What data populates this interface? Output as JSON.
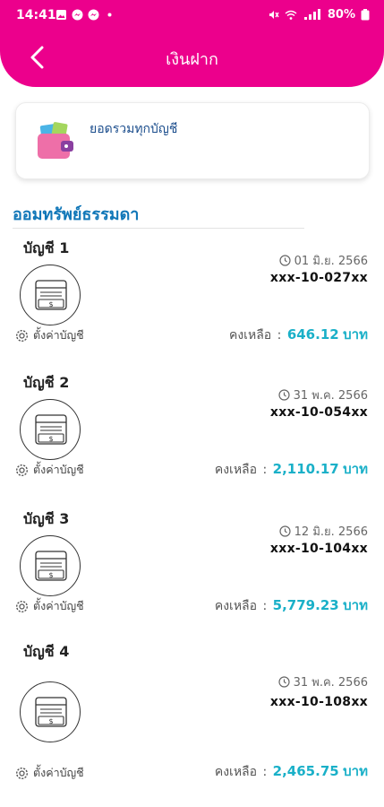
{
  "status_bar": {
    "time": "14:41",
    "battery": "80%"
  },
  "header": {
    "title": "เงินฝาก"
  },
  "summary": {
    "label": "ยอดรวมทุกบัญชี"
  },
  "section": {
    "title": "ออมทรัพย์ธรรมดา"
  },
  "accounts": [
    {
      "name": "บัญชี 1",
      "date": "01 มิ.ย. 2566",
      "number": "xxx-10-027xx",
      "settings_label": "ตั้งค่าบัญชี",
      "balance_label": "คงเหลือ",
      "colon": ":",
      "amount": "646.12",
      "currency": "บาท"
    },
    {
      "name": "บัญชี 2",
      "date": "31 พ.ค. 2566",
      "number": "xxx-10-054xx",
      "settings_label": "ตั้งค่าบัญชี",
      "balance_label": "คงเหลือ",
      "colon": ":",
      "amount": "2,110.17",
      "currency": "บาท"
    },
    {
      "name": "บัญชี 3",
      "date": "12 มิ.ย. 2566",
      "number": "xxx-10-104xx",
      "settings_label": "ตั้งค่าบัญชี",
      "balance_label": "คงเหลือ",
      "colon": ":",
      "amount": "5,779.23",
      "currency": "บาท"
    },
    {
      "name": "บัญชี 4",
      "date": "31 พ.ค. 2566",
      "number": "xxx-10-108xx",
      "settings_label": "ตั้งค่าบัญชี",
      "balance_label": "คงเหลือ",
      "colon": ":",
      "amount": "2,465.75",
      "currency": "บาท"
    }
  ],
  "colors": {
    "brand": "#ec008c",
    "section_title": "#1177b8",
    "amount": "#1ab0c8"
  }
}
